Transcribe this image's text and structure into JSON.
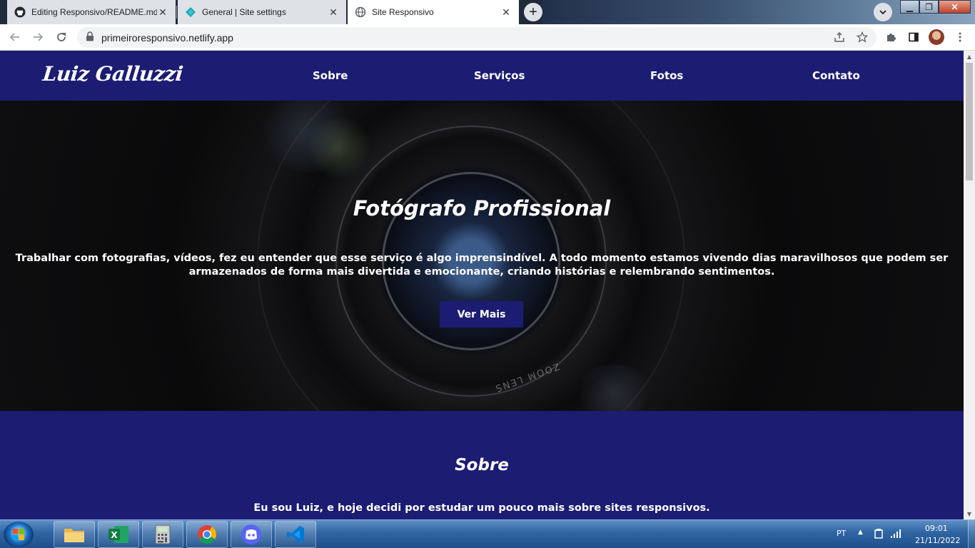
{
  "browser": {
    "tabs": [
      {
        "title": "Editing Responsivo/README.md",
        "icon": "github-icon",
        "active": false
      },
      {
        "title": "General | Site settings",
        "icon": "netlify-icon",
        "active": false
      },
      {
        "title": "Site Responsivo",
        "icon": "globe-icon",
        "active": true
      }
    ],
    "new_tab_label": "+",
    "url": "primeiroresponsivo.netlify.app"
  },
  "site": {
    "logo": "Luiz Galluzzi",
    "nav": [
      "Sobre",
      "Serviços",
      "Fotos",
      "Contato"
    ],
    "hero": {
      "title": "Fotógrafo Profissional",
      "text": "Trabalhar com fotografias, vídeos, fez eu entender que esse serviço é algo imprensindível. A todo momento estamos vivendo dias maravilhosos que podem ser armazenados de forma mais divertida e emocionante, criando histórias e relembrando sentimentos.",
      "button": "Ver Mais",
      "lens_text": "ZOOM LENS"
    },
    "about": {
      "title": "Sobre",
      "text": "Eu sou Luiz, e hoje decidi por estudar um pouco mais sobre sites responsivos."
    },
    "colors": {
      "navy": "#1c1c72",
      "hero_bg": "#0b0b0d"
    }
  },
  "taskbar": {
    "apps": [
      "explorer-icon",
      "excel-icon",
      "calculator-icon",
      "chrome-icon",
      "discord-icon",
      "vscode-icon"
    ],
    "language": "PT",
    "time": "09:01",
    "date": "21/11/2022"
  }
}
